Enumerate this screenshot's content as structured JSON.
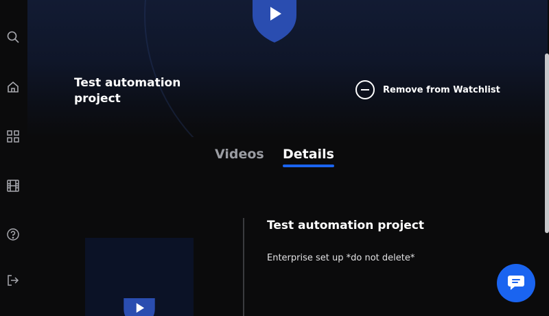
{
  "nav": {
    "items": [
      {
        "name": "search",
        "icon": "search-icon"
      },
      {
        "name": "home",
        "icon": "home-icon"
      },
      {
        "name": "categories",
        "icon": "grid-icon"
      },
      {
        "name": "videos",
        "icon": "film-icon"
      },
      {
        "name": "help",
        "icon": "help-icon"
      },
      {
        "name": "logout",
        "icon": "logout-icon"
      }
    ]
  },
  "hero": {
    "title": "Test automation project",
    "watchlist_label": "Remove from Watchlist",
    "watchlist_icon": "minus-circle-icon"
  },
  "tabs": [
    {
      "label": "Videos",
      "active": false
    },
    {
      "label": "Details",
      "active": true
    }
  ],
  "details": {
    "title": "Test automation project",
    "description": "Enterprise set up *do not delete*"
  },
  "colors": {
    "accent": "#1a64f0",
    "background": "#0b0b0c",
    "hero_top": "#121b33",
    "muted_text": "#9a9ca2"
  },
  "chat": {
    "icon": "chat-bubble-icon"
  }
}
